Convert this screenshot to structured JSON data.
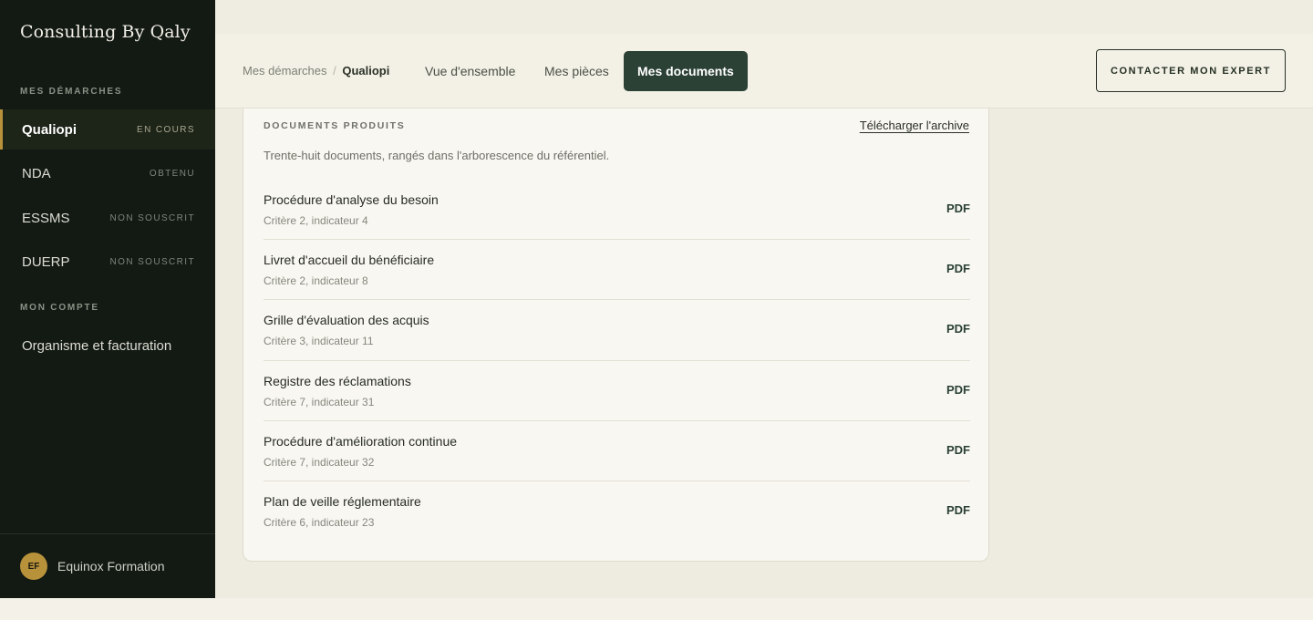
{
  "brand": "Consulting By Qaly",
  "sidebar": {
    "section_demarches": "MES DÉMARCHES",
    "items": [
      {
        "label": "Qualiopi",
        "status": "EN COURS"
      },
      {
        "label": "NDA",
        "status": "OBTENU"
      },
      {
        "label": "ESSMS",
        "status": "NON SOUSCRIT"
      },
      {
        "label": "DUERP",
        "status": "NON SOUSCRIT"
      }
    ],
    "section_compte": "MON COMPTE",
    "account_item": "Organisme et facturation",
    "footer": {
      "initials": "EF",
      "org_name": "Equinox Formation"
    }
  },
  "header": {
    "breadcrumb": {
      "parent": "Mes démarches",
      "separator": "/",
      "current": "Qualiopi"
    },
    "tabs": [
      {
        "label": "Vue d'ensemble"
      },
      {
        "label": "Mes pièces"
      },
      {
        "label": "Mes documents"
      }
    ],
    "contact_button": "CONTACTER MON EXPERT"
  },
  "documents": {
    "title": "DOCUMENTS PRODUITS",
    "archive_link": "Télécharger l'archive",
    "description": "Trente-huit documents, rangés dans l'arborescence du référentiel.",
    "items": [
      {
        "name": "Procédure d'analyse du besoin",
        "ref": "Critère 2, indicateur 4",
        "format": "PDF"
      },
      {
        "name": "Livret d'accueil du bénéficiaire",
        "ref": "Critère 2, indicateur 8",
        "format": "PDF"
      },
      {
        "name": "Grille d'évaluation des acquis",
        "ref": "Critère 3, indicateur 11",
        "format": "PDF"
      },
      {
        "name": "Registre des réclamations",
        "ref": "Critère 7, indicateur 31",
        "format": "PDF"
      },
      {
        "name": "Procédure d'amélioration continue",
        "ref": "Critère 7, indicateur 32",
        "format": "PDF"
      },
      {
        "name": "Plan de veille réglementaire",
        "ref": "Critère 6, indicateur 23",
        "format": "PDF"
      }
    ]
  },
  "colors": {
    "sidebar_bg": "#131a14",
    "accent_gold": "#b8923a",
    "primary_green": "#2b4136",
    "page_bg": "#eeece1"
  }
}
